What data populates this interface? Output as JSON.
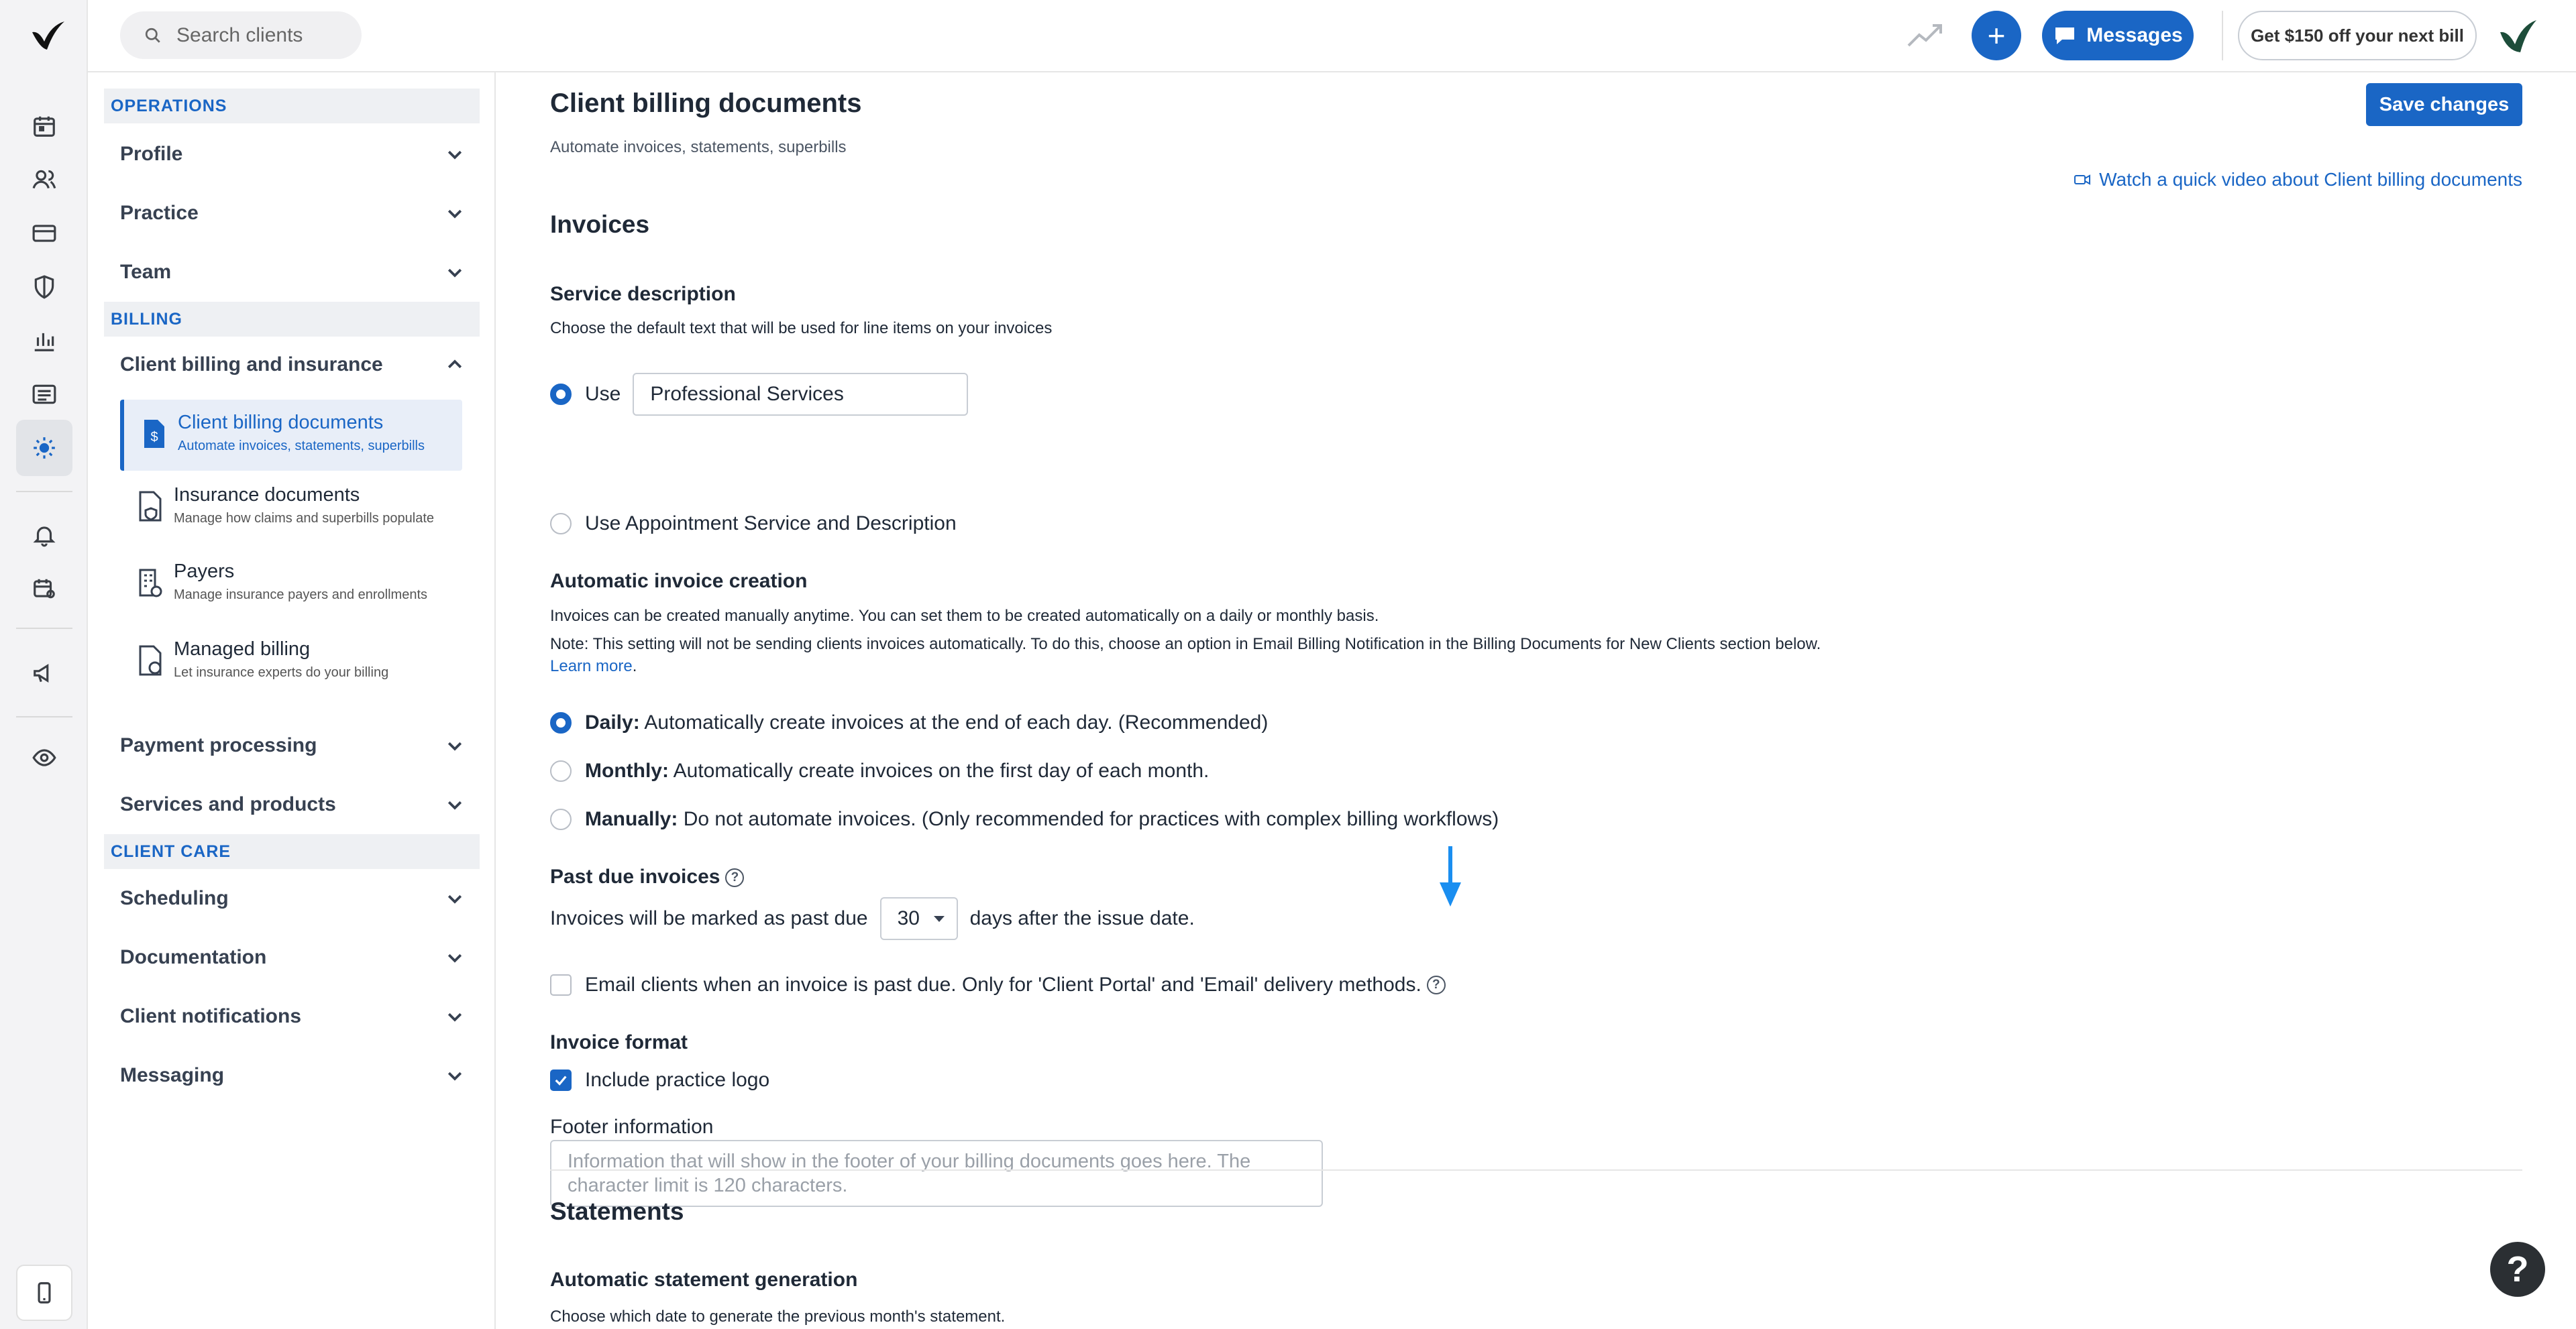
{
  "topbar": {
    "search_placeholder": "Search clients",
    "add_label": "+",
    "messages_label": "Messages",
    "promo_label": "Get $150 off your next bill"
  },
  "sidebar": {
    "sections": [
      {
        "title": "OPERATIONS",
        "items": [
          "Profile",
          "Practice",
          "Team"
        ]
      },
      {
        "title": "BILLING",
        "items": [
          "Client billing and insurance"
        ]
      },
      {
        "title": "CLIENT CARE",
        "items": [
          "Scheduling",
          "Documentation",
          "Client notifications",
          "Messaging"
        ]
      }
    ],
    "billing_sub": [
      {
        "title": "Client billing documents",
        "desc": "Automate invoices, statements, superbills"
      },
      {
        "title": "Insurance documents",
        "desc": "Manage how claims and superbills populate"
      },
      {
        "title": "Payers",
        "desc": "Manage insurance payers and enrollments"
      },
      {
        "title": "Managed billing",
        "desc": "Let insurance experts do your billing"
      }
    ],
    "billing_more": [
      "Payment processing",
      "Services and products"
    ]
  },
  "main": {
    "title": "Client billing documents",
    "subtitle": "Automate invoices, statements, superbills",
    "save_label": "Save changes",
    "video_link": "Watch a quick video about Client billing documents",
    "invoices_heading": "Invoices",
    "service_desc": {
      "heading": "Service description",
      "help": "Choose the default text that will be used for line items on your invoices",
      "use_label": "Use",
      "use_value": "Professional Services",
      "alt_label": "Use Appointment Service and Description"
    },
    "auto_invoice": {
      "heading": "Automatic invoice creation",
      "line1": "Invoices can be created manually anytime. You can set them to be created automatically on a daily or monthly basis.",
      "line2": "Note: This setting will not be sending clients invoices automatically. To do this, choose an option in Email Billing Notification in the Billing Documents for New Clients section below.",
      "learn_more": "Learn more",
      "period": ".",
      "options": [
        {
          "bold": "Daily:",
          "text": " Automatically create invoices at the end of each day. (Recommended)",
          "selected": true
        },
        {
          "bold": "Monthly:",
          "text": " Automatically create invoices on the first day of each month.",
          "selected": false
        },
        {
          "bold": "Manually:",
          "text": " Do not automate invoices. (Only recommended for practices with complex billing workflows)",
          "selected": false
        }
      ]
    },
    "past_due": {
      "heading": "Past due invoices",
      "prefix": "Invoices will be marked as past due",
      "days_value": "30",
      "suffix": "days after the issue date.",
      "email_label": "Email clients when an invoice is past due. Only for 'Client Portal' and 'Email' delivery methods.",
      "email_checked": false
    },
    "invoice_format": {
      "heading": "Invoice format",
      "logo_label": "Include practice logo",
      "logo_checked": true,
      "footer_label": "Footer information",
      "footer_placeholder": "Information that will show in the footer of your billing documents goes here. The character limit is 120 characters."
    },
    "statements_heading": "Statements",
    "auto_statement": {
      "heading": "Automatic statement generation",
      "help": "Choose which date to generate the previous month's statement."
    }
  },
  "help_fab": "?",
  "colors": {
    "accent": "#1a66c5",
    "rail_bg": "#f3f3f5"
  }
}
